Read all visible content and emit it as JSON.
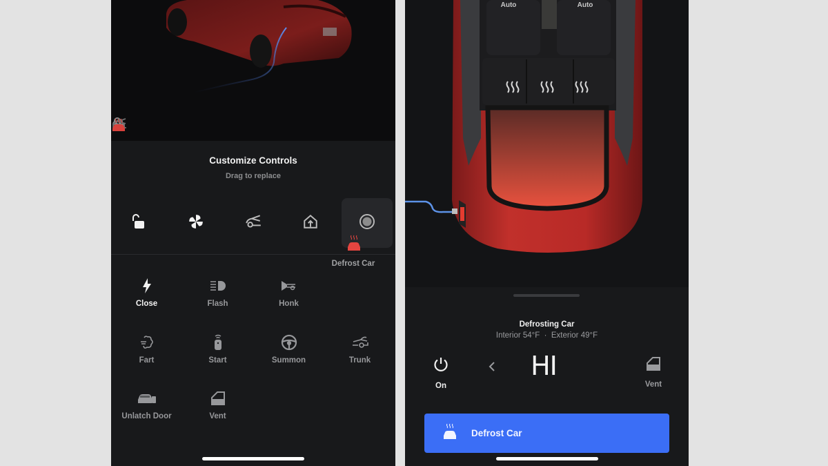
{
  "left_phone": {
    "quick_bar": [
      {
        "icon": "unlock-icon",
        "active": false
      },
      {
        "icon": "fan-icon",
        "active": false
      },
      {
        "icon": "frunk-icon",
        "active": false
      },
      {
        "icon": "homelink-icon",
        "active": false
      },
      {
        "icon": "defrost-car-icon",
        "active": true
      }
    ],
    "sheet": {
      "title": "Customize Controls",
      "subtitle": "Drag to replace"
    },
    "slots": [
      {
        "icon": "unlock-icon"
      },
      {
        "icon": "fan-icon"
      },
      {
        "icon": "frunk-icon"
      },
      {
        "icon": "homelink-icon"
      },
      {
        "icon": "empty-slot-icon",
        "active": true
      }
    ],
    "dragging": {
      "icon": "defrost-car-icon",
      "label": "Defrost Car"
    },
    "controls": [
      {
        "icon": "bolt-icon",
        "label": "Close",
        "selected": true
      },
      {
        "icon": "headlight-flash-icon",
        "label": "Flash"
      },
      {
        "icon": "horn-icon",
        "label": "Honk"
      },
      {
        "icon": "fart-icon",
        "label": "Fart"
      },
      {
        "icon": "key-fob-icon",
        "label": "Start"
      },
      {
        "icon": "steering-wheel-icon",
        "label": "Summon"
      },
      {
        "icon": "trunk-icon",
        "label": "Trunk"
      },
      {
        "icon": "car-door-icon",
        "label": "Unlatch Door"
      },
      {
        "icon": "window-vent-icon",
        "label": "Vent"
      }
    ]
  },
  "right_phone": {
    "seats": {
      "front_left": "Auto",
      "front_right": "Auto"
    },
    "status": {
      "title": "Defrosting Car",
      "interior": "Interior 54°F",
      "separator": "·",
      "exterior": "Exterior 49°F",
      "line": "Interior 54°F  ·  Exterior 49°F"
    },
    "power": {
      "label": "On"
    },
    "level": "HI",
    "vent": {
      "label": "Vent"
    },
    "primary_button": {
      "label": "Defrost Car",
      "color": "#3b6ef6"
    }
  },
  "colors": {
    "accent_red": "#e0413c",
    "accent_blue": "#3b6ef6",
    "panel_bg": "#18191b",
    "text_primary": "#f2f2f2",
    "text_secondary": "#97989b"
  }
}
